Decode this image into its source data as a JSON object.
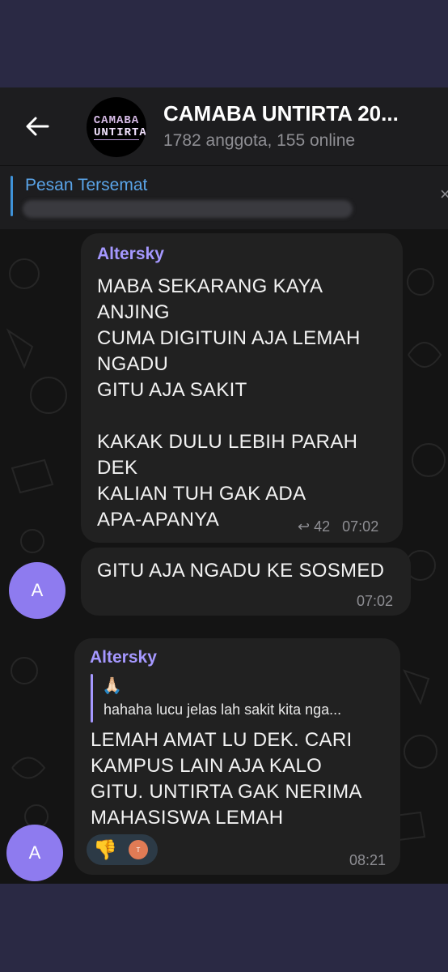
{
  "header": {
    "title": "CAMABA UNTIRTA 20...",
    "subtitle": "1782 anggota, 155 online",
    "avatar_line1": "CAMABA",
    "avatar_line2": "UNTIRTA"
  },
  "pinned": {
    "label": "Pesan Tersemat"
  },
  "messages": [
    {
      "sender": "Altersky",
      "text": "MABA SEKARANG KAYA\nANJING\nCUMA DIGITUIN AJA LEMAH\nNGADU\nGITU AJA SAKIT\n\nKAKAK DULU LEBIH PARAH\nDEK\nKALIAN TUH GAK ADA\nAPA-APANYA",
      "replies": "42",
      "time": "07:02"
    },
    {
      "avatar": "A",
      "text": "GITU AJA NGADU KE SOSMED",
      "time": "07:02"
    },
    {
      "sender": "Altersky",
      "reply_emoji": "🙏🏻",
      "reply_text": "hahaha lucu jelas lah sakit kita nga...",
      "text": "LEMAH AMAT LU DEK. CARI\nKAMPUS LAIN AJA KALO\nGITU. UNTIRTA GAK NERIMA\nMAHASISWA LEMAH",
      "reaction": "👎",
      "reaction_avatar": "T",
      "time": "08:21",
      "avatar": "A"
    }
  ],
  "colors": {
    "accent_name": "#a598ff",
    "pinned": "#5aa4e8",
    "avatar": "#8e7bef",
    "bubble": "#212121"
  }
}
